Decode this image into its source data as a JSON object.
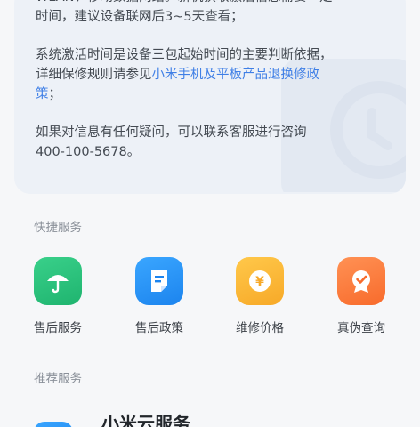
{
  "info": {
    "line1": "WLAN、移动数据网络。新机获取激活信息需要一定",
    "line2": "时间，建议设备联网后3~5天查看；",
    "line3": "系统激活时间是设备三包起始时间的主要判断依据，",
    "line4_prefix": "详细保修规则请参见",
    "line4_link": "小米手机及平板产品退换修政",
    "line5_link": "策",
    "line5_suffix": "；",
    "line6": "如果对信息有任何疑问，可以联系客服进行咨询",
    "line7": "400-100-5678。"
  },
  "quick_services": {
    "title": "快捷服务",
    "items": [
      {
        "label": "售后服务",
        "icon": "umbrella-icon"
      },
      {
        "label": "售后政策",
        "icon": "document-icon"
      },
      {
        "label": "维修价格",
        "icon": "yuan-coin-icon"
      },
      {
        "label": "真伪查询",
        "icon": "verified-badge-icon"
      }
    ]
  },
  "recommended": {
    "title": "推荐服务",
    "item_name": "小米云服务"
  },
  "colors": {
    "link": "#3f7fe6",
    "green": "#1fb46f",
    "blue": "#1c84ee",
    "yellow": "#f7a928",
    "orange": "#f86b2c"
  }
}
